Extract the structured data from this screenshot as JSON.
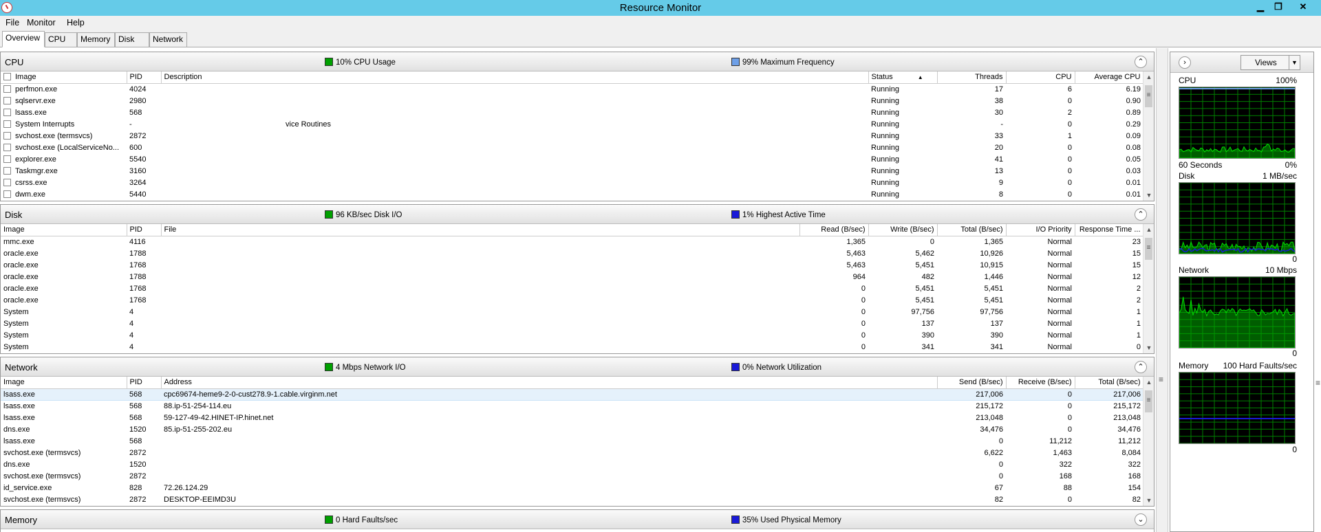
{
  "window": {
    "title": "Resource Monitor",
    "min": "▁",
    "restore": "❐",
    "close": "✕"
  },
  "menu": [
    "File",
    "Monitor",
    "Help"
  ],
  "tabs": [
    "Overview",
    "CPU",
    "Memory",
    "Disk",
    "Network"
  ],
  "cpu": {
    "name": "CPU",
    "ind1": "10% CPU Usage",
    "ind2": "99% Maximum Frequency",
    "collapse": "⌃",
    "cols": [
      "Image",
      "PID",
      "Description",
      "Status",
      "Threads",
      "CPU",
      "Average CPU"
    ],
    "rows": [
      [
        "perfmon.exe",
        "4024",
        "",
        "Running",
        "17",
        "6",
        "6.19"
      ],
      [
        "sqlservr.exe",
        "2980",
        "",
        "Running",
        "38",
        "0",
        "0.90"
      ],
      [
        "lsass.exe",
        "568",
        "",
        "Running",
        "30",
        "2",
        "0.89"
      ],
      [
        "System Interrupts",
        "-",
        "vice Routines",
        "Running",
        "-",
        "0",
        "0.29"
      ],
      [
        "svchost.exe (termsvcs)",
        "2872",
        "",
        "Running",
        "33",
        "1",
        "0.09"
      ],
      [
        "svchost.exe (LocalServiceNo...",
        "600",
        "",
        "Running",
        "20",
        "0",
        "0.08"
      ],
      [
        "explorer.exe",
        "5540",
        "",
        "Running",
        "41",
        "0",
        "0.05"
      ],
      [
        "Taskmgr.exe",
        "3160",
        "",
        "Running",
        "13",
        "0",
        "0.03"
      ],
      [
        "csrss.exe",
        "3264",
        "",
        "Running",
        "9",
        "0",
        "0.01"
      ],
      [
        "dwm.exe",
        "5440",
        "",
        "Running",
        "8",
        "0",
        "0.01"
      ]
    ]
  },
  "disk": {
    "name": "Disk",
    "ind1": "96 KB/sec Disk I/O",
    "ind2": "1% Highest Active Time",
    "collapse": "⌃",
    "cols": [
      "Image",
      "PID",
      "File",
      "Read (B/sec)",
      "Write (B/sec)",
      "Total (B/sec)",
      "I/O Priority",
      "Response Time ..."
    ],
    "rows": [
      [
        "mmc.exe",
        "4116",
        "",
        "1,365",
        "0",
        "1,365",
        "Normal",
        "23"
      ],
      [
        "oracle.exe",
        "1788",
        "",
        "5,463",
        "5,462",
        "10,926",
        "Normal",
        "15"
      ],
      [
        "oracle.exe",
        "1768",
        "",
        "5,463",
        "5,451",
        "10,915",
        "Normal",
        "15"
      ],
      [
        "oracle.exe",
        "1788",
        "",
        "964",
        "482",
        "1,446",
        "Normal",
        "12"
      ],
      [
        "oracle.exe",
        "1768",
        "",
        "0",
        "5,451",
        "5,451",
        "Normal",
        "2"
      ],
      [
        "oracle.exe",
        "1768",
        "",
        "0",
        "5,451",
        "5,451",
        "Normal",
        "2"
      ],
      [
        "System",
        "4",
        "",
        "0",
        "97,756",
        "97,756",
        "Normal",
        "1"
      ],
      [
        "System",
        "4",
        "",
        "0",
        "137",
        "137",
        "Normal",
        "1"
      ],
      [
        "System",
        "4",
        "",
        "0",
        "390",
        "390",
        "Normal",
        "1"
      ],
      [
        "System",
        "4",
        "",
        "0",
        "341",
        "341",
        "Normal",
        "0"
      ]
    ]
  },
  "network": {
    "name": "Network",
    "ind1": "4 Mbps Network I/O",
    "ind2": "0% Network Utilization",
    "collapse": "⌃",
    "cols": [
      "Image",
      "PID",
      "Address",
      "Send (B/sec)",
      "Receive (B/sec)",
      "Total (B/sec)"
    ],
    "rows": [
      [
        "lsass.exe",
        "568",
        "cpc69674-heme9-2-0-cust278.9-1.cable.virginm.net",
        "217,006",
        "0",
        "217,006"
      ],
      [
        "lsass.exe",
        "568",
        "88.ip-51-254-114.eu",
        "215,172",
        "0",
        "215,172"
      ],
      [
        "lsass.exe",
        "568",
        "59-127-49-42.HINET-IP.hinet.net",
        "213,048",
        "0",
        "213,048"
      ],
      [
        "dns.exe",
        "1520",
        "85.ip-51-255-202.eu",
        "34,476",
        "0",
        "34,476"
      ],
      [
        "lsass.exe",
        "568",
        "",
        "0",
        "11,212",
        "11,212"
      ],
      [
        "svchost.exe (termsvcs)",
        "2872",
        "",
        "6,622",
        "1,463",
        "8,084"
      ],
      [
        "dns.exe",
        "1520",
        "",
        "0",
        "322",
        "322"
      ],
      [
        "svchost.exe (termsvcs)",
        "2872",
        "",
        "0",
        "168",
        "168"
      ],
      [
        "id_service.exe",
        "828",
        "72.26.124.29",
        "67",
        "88",
        "154"
      ],
      [
        "svchost.exe (termsvcs)",
        "2872",
        "DESKTOP-EEIMD3U",
        "82",
        "0",
        "82"
      ]
    ]
  },
  "memory": {
    "name": "Memory",
    "ind1": "0 Hard Faults/sec",
    "ind2": "35% Used Physical Memory",
    "collapse": "⌄"
  },
  "right": {
    "views": "Views",
    "g_cpu": "CPU",
    "g_cpu_max": "100%",
    "g_cpu_time": "60 Seconds",
    "g_cpu_min": "0%",
    "g_disk": "Disk",
    "g_disk_max": "1 MB/sec",
    "g_disk_min": "0",
    "g_net": "Network",
    "g_net_max": "10 Mbps",
    "g_net_min": "0",
    "g_mem": "Memory",
    "g_mem_max": "100 Hard Faults/sec",
    "g_mem_min": "0"
  },
  "colors": {
    "green": "#00a000",
    "blue": "#1a1ad8",
    "lightblue": "#6ea0e8",
    "graph_bg": "#000000",
    "grid": "#008000"
  }
}
